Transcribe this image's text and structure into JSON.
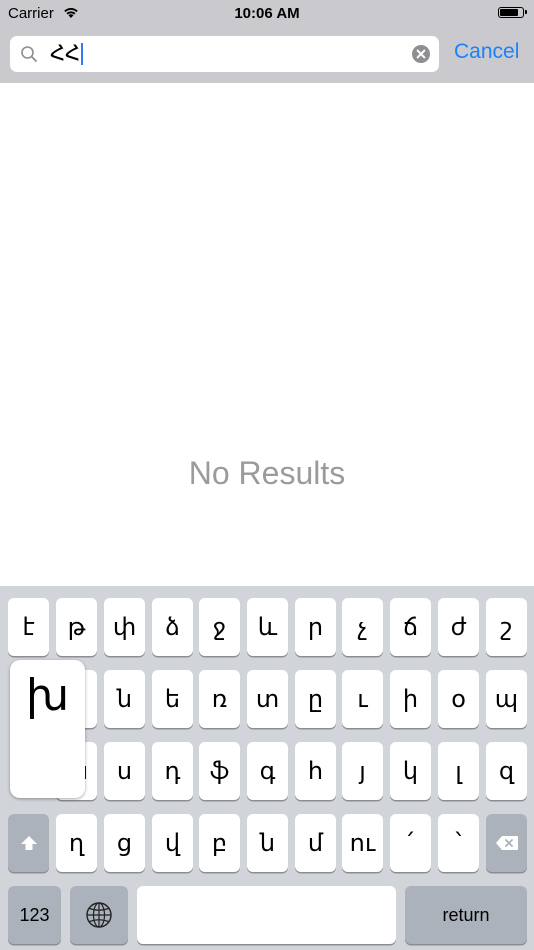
{
  "status_bar": {
    "carrier": "Carrier",
    "time": "10:06 AM"
  },
  "search": {
    "value": "ՀՀ",
    "cancel_label": "Cancel"
  },
  "content": {
    "message": "No Results"
  },
  "keyboard": {
    "row1": [
      "է",
      "թ",
      "փ",
      "ձ",
      "ջ",
      "և",
      "ր",
      "չ",
      "ճ",
      "ժ",
      "շ"
    ],
    "row2": [
      "ն",
      "ե",
      "ռ",
      "տ",
      "ը",
      "ւ",
      "ի",
      "օ",
      "պ"
    ],
    "row3": [
      "ա",
      "ս",
      "դ",
      "ֆ",
      "գ",
      "հ",
      "յ",
      "կ",
      "լ",
      "զ"
    ],
    "row4": [
      "ղ",
      "ց",
      "վ",
      "բ",
      "ն",
      "մ",
      "ու",
      "՛",
      "՝"
    ],
    "popup_key": "խ",
    "numbers_label": "123",
    "return_label": "return"
  }
}
